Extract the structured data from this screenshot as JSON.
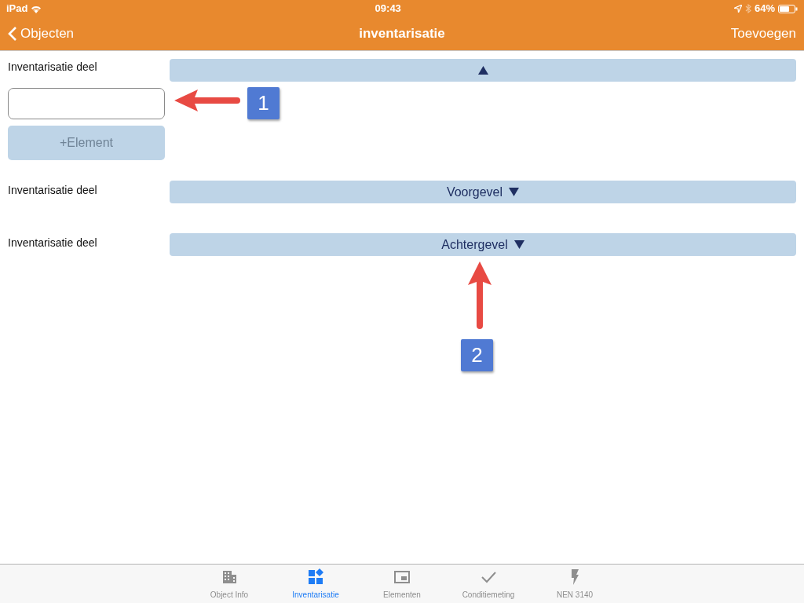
{
  "status_bar": {
    "device": "iPad",
    "time": "09:43",
    "battery": "64%"
  },
  "nav_bar": {
    "back": "Objecten",
    "title": "inventarisatie",
    "action": "Toevoegen"
  },
  "sections": [
    {
      "label": "Inventarisatie deel",
      "expanded": true,
      "kind": "form",
      "add_button": {
        "label": "+Element",
        "disabled": true
      }
    },
    {
      "label": "Inventarisatie deel",
      "title": "Voorgevel",
      "expanded": false
    },
    {
      "label": "Inventarisatie deel",
      "title": "Achtergevel",
      "expanded": false
    }
  ],
  "annotations": [
    {
      "number": "1",
      "kind": "left"
    },
    {
      "number": "2",
      "kind": "up"
    }
  ],
  "tab_bar": [
    {
      "label": "Object Info",
      "kind": "building",
      "selected": false
    },
    {
      "label": "Inventarisatie",
      "kind": "blocks",
      "selected": true
    },
    {
      "label": "Elementen",
      "kind": "frame",
      "selected": false
    },
    {
      "label": "Conditiemeting",
      "kind": "check",
      "selected": false
    },
    {
      "label": "NEN 3140",
      "kind": "bolt",
      "selected": false
    }
  ]
}
